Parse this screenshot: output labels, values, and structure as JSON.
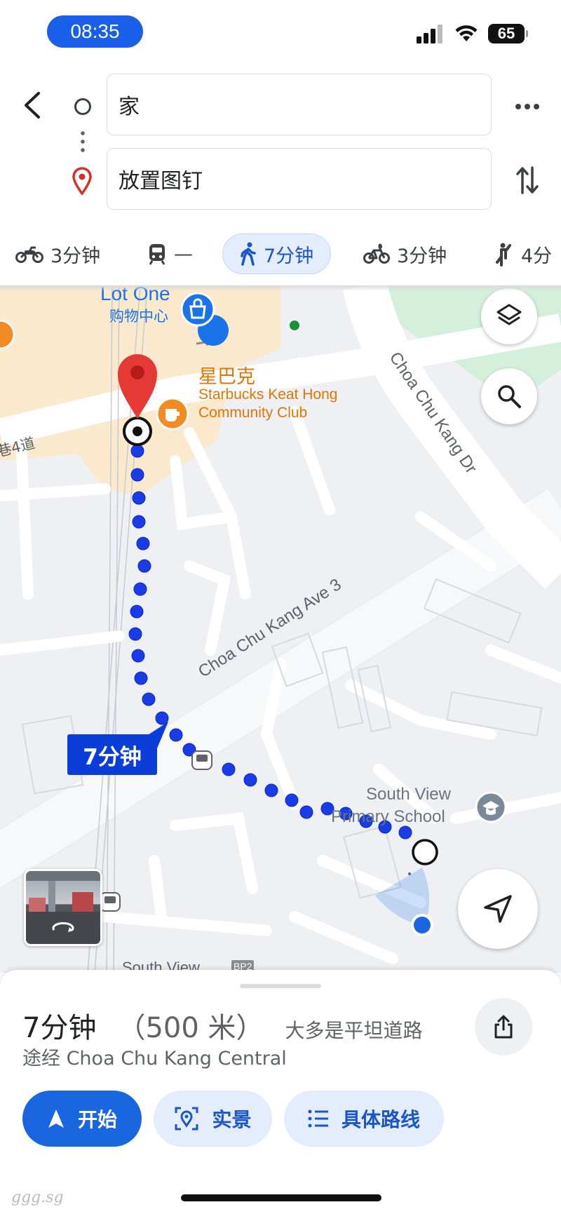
{
  "status_bar": {
    "time": "08:35",
    "battery": "65"
  },
  "search": {
    "origin_value": "家",
    "destination_placeholder": "放置图钉"
  },
  "modes": [
    {
      "name": "motorcycle",
      "label": "3分钟",
      "icon": "motorcycle-icon",
      "active": false
    },
    {
      "name": "transit",
      "label": "—",
      "icon": "train-icon",
      "active": false
    },
    {
      "name": "walking",
      "label": "7分钟",
      "icon": "walking-icon",
      "active": true
    },
    {
      "name": "cycling",
      "label": "3分钟",
      "icon": "bicycle-icon",
      "active": false
    },
    {
      "name": "ride-hailing",
      "label": "4分",
      "icon": "hail-ride-icon",
      "active": false
    }
  ],
  "map": {
    "labels": {
      "lot_one": "Lot One",
      "shopping_centre": "购物中心",
      "starbucks_cn": "星巴克",
      "starbucks_en_1": "Starbucks Keat Hong",
      "starbucks_en_2": "Community Club",
      "street_4": "巷4道",
      "choa_chu_kang_dr": "Choa Chu Kang Dr",
      "choa_chu_kang_ave3": "Choa Chu Kang Ave 3",
      "school_1": "South View",
      "school_2": "Primary School",
      "south_view": "South View",
      "bp2": "BP2"
    },
    "route_duration": "7分钟"
  },
  "sheet": {
    "duration": "7分钟",
    "distance": "（500 米）",
    "terrain_note": "大多是平坦道路",
    "via": "途经 Choa Chu Kang Central",
    "start_label": "开始",
    "live_view_label": "实景",
    "steps_label": "具体路线"
  },
  "watermark": "ggg.sg",
  "colors": {
    "route": "#1a3be8",
    "accent": "#1a66e0",
    "park": "#d4f0dc",
    "mall": "#fbe8c8"
  }
}
